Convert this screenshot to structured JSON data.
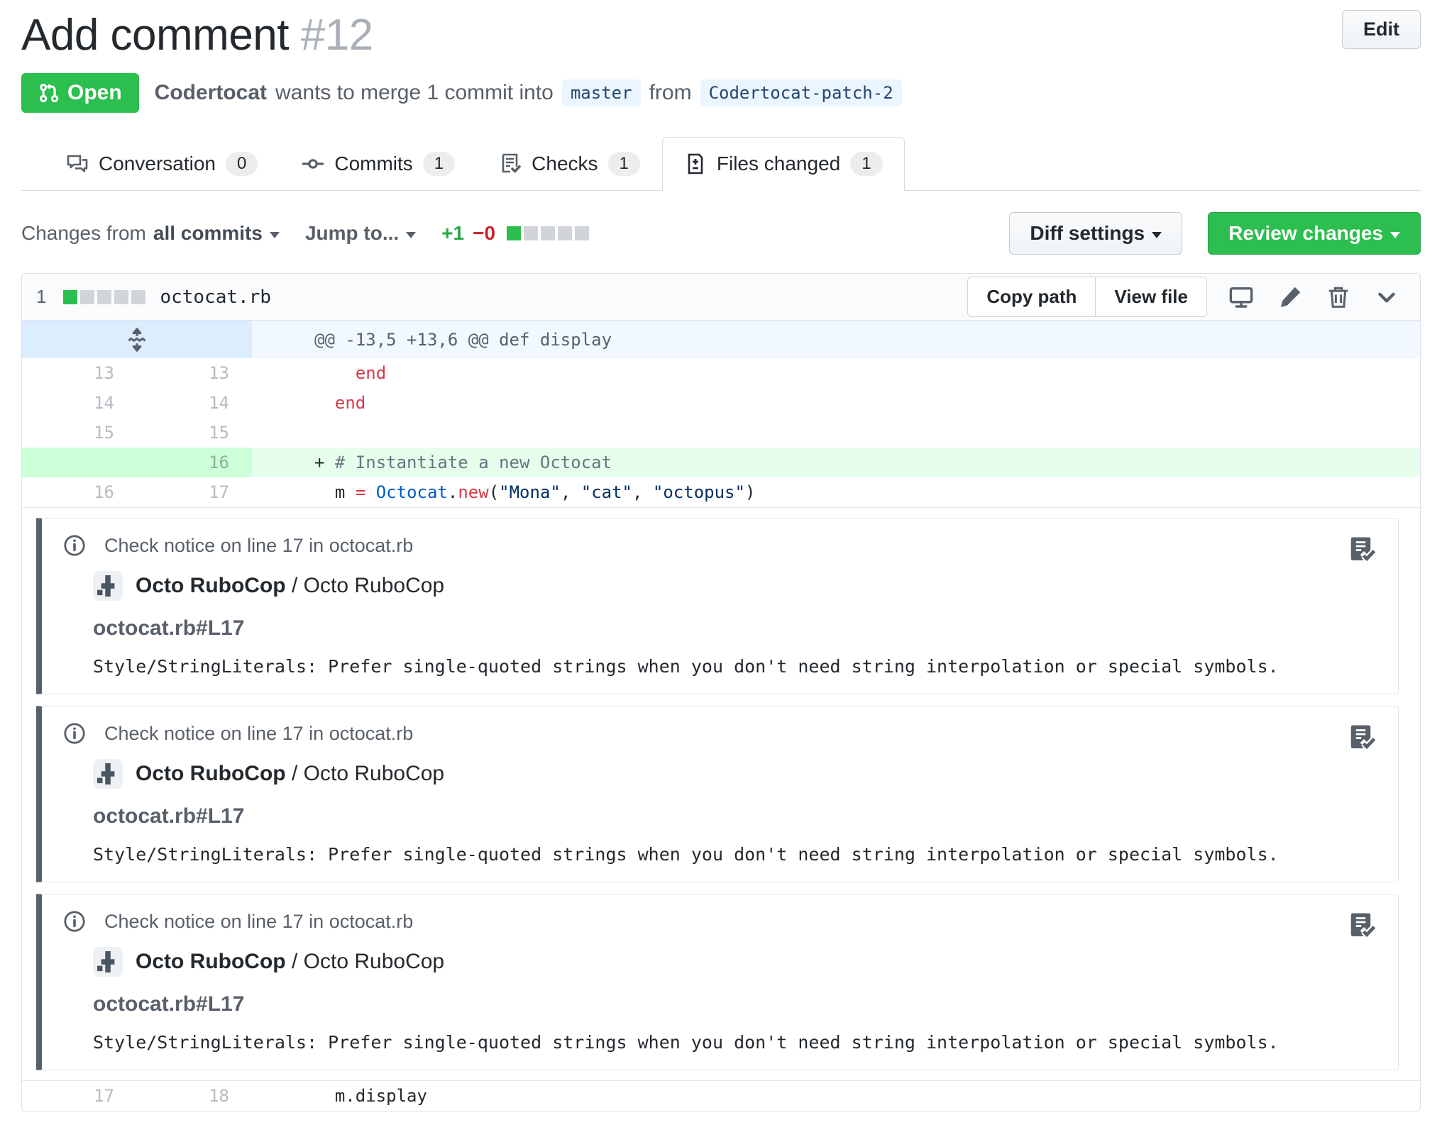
{
  "page": {
    "title": "Add comment",
    "number": "#12",
    "edit_label": "Edit"
  },
  "status": {
    "state_label": "Open",
    "author": "Codertocat",
    "merge_text": "wants to merge 1 commit into",
    "base_branch": "master",
    "from_text": "from",
    "head_branch": "Codertocat-patch-2"
  },
  "tabs": [
    {
      "label": "Conversation",
      "count": "0",
      "active": false
    },
    {
      "label": "Commits",
      "count": "1",
      "active": false
    },
    {
      "label": "Checks",
      "count": "1",
      "active": false
    },
    {
      "label": "Files changed",
      "count": "1",
      "active": true
    }
  ],
  "toolbar": {
    "changes_from": "Changes from",
    "changes_from_value": "all commits",
    "jump_to": "Jump to...",
    "additions": "+1",
    "deletions": "−0",
    "diffstat_green_blocks": 1,
    "diffstat_gray_blocks": 4,
    "diff_settings_label": "Diff settings",
    "review_changes_label": "Review changes"
  },
  "file": {
    "stat_number": "1",
    "stat_green_blocks": 1,
    "stat_gray_blocks": 4,
    "name": "octocat.rb",
    "copy_path_label": "Copy path",
    "view_file_label": "View file"
  },
  "diff": {
    "hunk_header": "@@ -13,5 +13,6 @@ def display",
    "rows": [
      {
        "old": "13",
        "new": "13",
        "type": "ctx",
        "segs": [
          [
            "  ",
            "p"
          ],
          [
            "end",
            "k"
          ]
        ]
      },
      {
        "old": "14",
        "new": "14",
        "type": "ctx",
        "segs": [
          [
            "end",
            "k"
          ]
        ]
      },
      {
        "old": "15",
        "new": "15",
        "type": "ctx",
        "segs": []
      },
      {
        "old": "",
        "new": "16",
        "type": "add",
        "segs": [
          [
            "# Instantiate a new Octocat",
            "cm"
          ]
        ]
      },
      {
        "old": "16",
        "new": "17",
        "type": "ctx",
        "segs": [
          [
            "m ",
            "p"
          ],
          [
            "=",
            "k"
          ],
          [
            " ",
            "p"
          ],
          [
            "Octocat",
            "c"
          ],
          [
            ".",
            "p"
          ],
          [
            "new",
            "k"
          ],
          [
            "(",
            "p"
          ],
          [
            "\"Mona\"",
            "s"
          ],
          [
            ", ",
            "p"
          ],
          [
            "\"cat\"",
            "s"
          ],
          [
            ", ",
            "p"
          ],
          [
            "\"octopus\"",
            "s"
          ],
          [
            ")",
            "p"
          ]
        ]
      }
    ],
    "bottom_rows": [
      {
        "old": "17",
        "new": "18",
        "type": "ctx",
        "segs": [
          [
            "m.display",
            "p"
          ]
        ]
      }
    ]
  },
  "notices": [
    {
      "heading": "Check notice on line 17 in octocat.rb",
      "app_name": "Octo RuboCop",
      "separator": " / ",
      "app_context": "Octo RuboCop",
      "file_line": "octocat.rb#L17",
      "message": "Style/StringLiterals: Prefer single-quoted strings when you don't need string interpolation or special symbols."
    },
    {
      "heading": "Check notice on line 17 in octocat.rb",
      "app_name": "Octo RuboCop",
      "separator": " / ",
      "app_context": "Octo RuboCop",
      "file_line": "octocat.rb#L17",
      "message": "Style/StringLiterals: Prefer single-quoted strings when you don't need string interpolation or special symbols."
    },
    {
      "heading": "Check notice on line 17 in octocat.rb",
      "app_name": "Octo RuboCop",
      "separator": " / ",
      "app_context": "Octo RuboCop",
      "file_line": "octocat.rb#L17",
      "message": "Style/StringLiterals: Prefer single-quoted strings when you don't need string interpolation or special symbols."
    }
  ],
  "colors": {
    "accent_green": "#2cbe4e",
    "danger_red": "#cb2431",
    "branch_label_bg": "#eaf5ff",
    "hunk_gutter_bg": "#dbedff",
    "hunk_code_bg": "#f1f8ff",
    "added_gutter_bg": "#cdffd8",
    "added_code_bg": "#e6ffed",
    "syntax_keyword": "#d73a49",
    "syntax_constant": "#005cc5",
    "syntax_string": "#032f62",
    "syntax_comment": "#6a737d",
    "notice_bar": "#586069"
  }
}
